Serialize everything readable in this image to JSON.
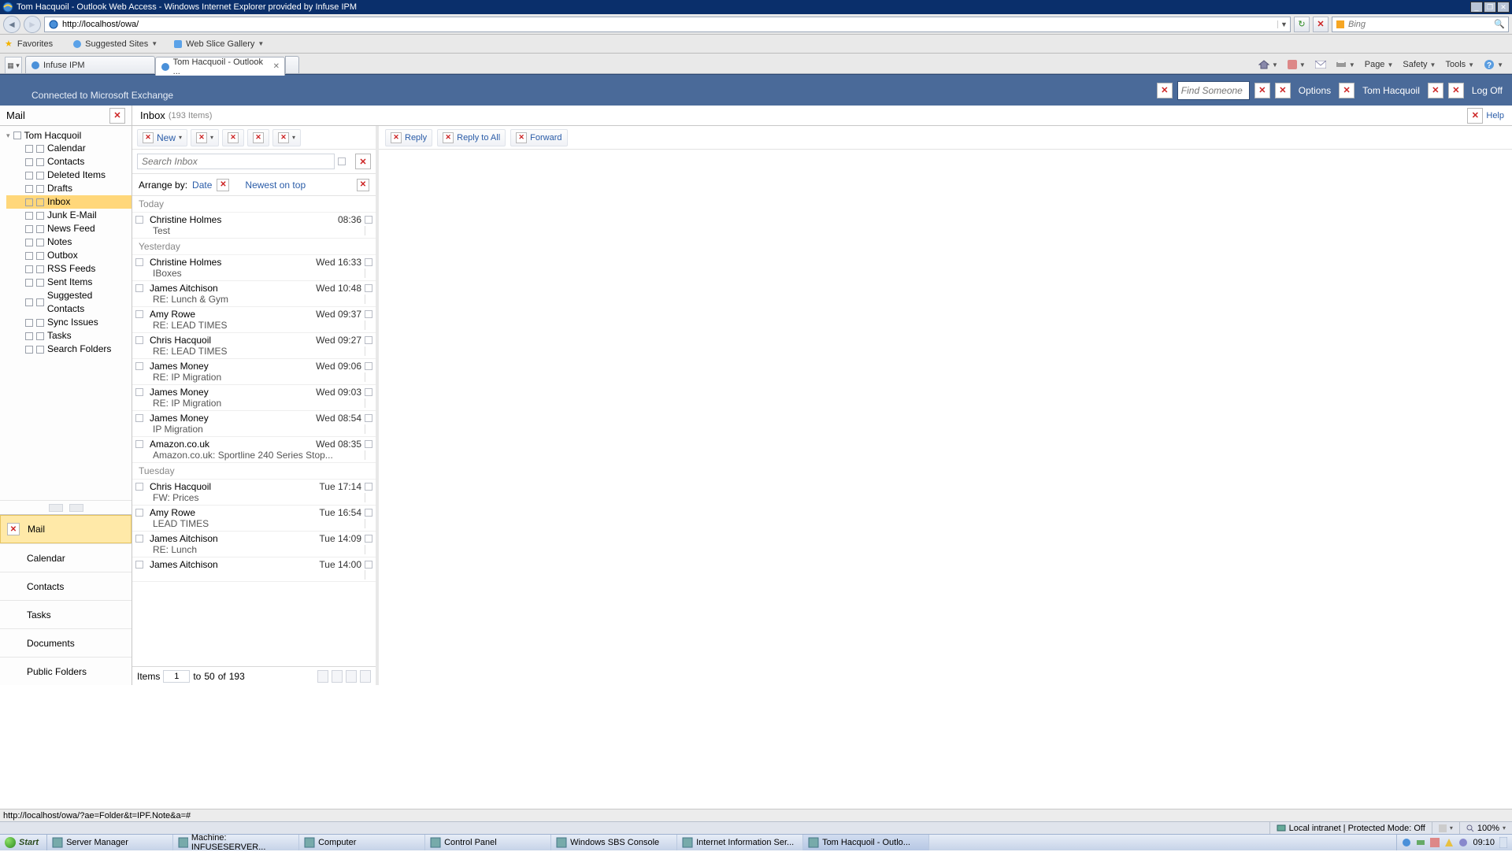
{
  "window": {
    "title": "Tom Hacquoil - Outlook Web Access - Windows Internet Explorer provided by Infuse IPM"
  },
  "ie": {
    "url": "http://localhost/owa/",
    "search_engine": "Bing",
    "favorites_label": "Favorites",
    "suggested_sites": "Suggested Sites",
    "web_slice": "Web Slice Gallery",
    "tabs": [
      {
        "label": "Infuse IPM",
        "active": false
      },
      {
        "label": "Tom Hacquoil - Outlook ...",
        "active": true
      }
    ],
    "menu": {
      "page": "Page",
      "safety": "Safety",
      "tools": "Tools"
    }
  },
  "owa": {
    "connected": "Connected to Microsoft Exchange",
    "find_placeholder": "Find Someone",
    "options": "Options",
    "user": "Tom Hacquoil",
    "logoff": "Log Off"
  },
  "sidebar": {
    "title": "Mail",
    "root": "Tom Hacquoil",
    "folders": [
      "Calendar",
      "Contacts",
      "Deleted Items",
      "Drafts",
      "Inbox",
      "Junk E-Mail",
      "News Feed",
      "Notes",
      "Outbox",
      "RSS Feeds",
      "Sent Items",
      "Suggested Contacts",
      "Sync Issues",
      "Tasks",
      "Search Folders"
    ],
    "selected": "Inbox",
    "nav": [
      "Mail",
      "Calendar",
      "Contacts",
      "Tasks",
      "Documents",
      "Public Folders"
    ]
  },
  "inbox": {
    "title": "Inbox",
    "count_label": "(193 Items)",
    "help": "Help",
    "new": "New",
    "reply": "Reply",
    "reply_all": "Reply to All",
    "forward": "Forward",
    "search_placeholder": "Search Inbox",
    "arrange_by": "Arrange by:",
    "arrange_field": "Date",
    "sort": "Newest on top",
    "pager": {
      "items": "Items",
      "page": "1",
      "to": "to",
      "range_end": "50",
      "of": "of",
      "total": "193"
    }
  },
  "groups": [
    {
      "label": "Today",
      "items": [
        {
          "from": "Christine Holmes",
          "time": "08:36",
          "subject": "Test"
        }
      ]
    },
    {
      "label": "Yesterday",
      "items": [
        {
          "from": "Christine Holmes",
          "time": "Wed 16:33",
          "subject": "IBoxes"
        },
        {
          "from": "James Aitchison",
          "time": "Wed 10:48",
          "subject": "RE: Lunch & Gym"
        },
        {
          "from": "Amy Rowe",
          "time": "Wed 09:37",
          "subject": "RE: LEAD TIMES"
        },
        {
          "from": "Chris Hacquoil",
          "time": "Wed 09:27",
          "subject": "RE: LEAD TIMES"
        },
        {
          "from": "James Money",
          "time": "Wed 09:06",
          "subject": "RE: IP Migration"
        },
        {
          "from": "James Money",
          "time": "Wed 09:03",
          "subject": "RE: IP Migration"
        },
        {
          "from": "James Money",
          "time": "Wed 08:54",
          "subject": "IP Migration"
        },
        {
          "from": "Amazon.co.uk",
          "time": "Wed 08:35",
          "subject": "Amazon.co.uk: Sportline 240 Series Stop..."
        }
      ]
    },
    {
      "label": "Tuesday",
      "items": [
        {
          "from": "Chris Hacquoil",
          "time": "Tue 17:14",
          "subject": "FW: Prices"
        },
        {
          "from": "Amy Rowe",
          "time": "Tue 16:54",
          "subject": "LEAD TIMES"
        },
        {
          "from": "James Aitchison",
          "time": "Tue 14:09",
          "subject": "RE: Lunch"
        },
        {
          "from": "James Aitchison",
          "time": "Tue 14:00",
          "subject": ""
        }
      ]
    }
  ],
  "status": {
    "hover_url": "http://localhost/owa/?ae=Folder&t=IPF.Note&a=#",
    "zone": "Local intranet | Protected Mode: Off",
    "zoom": "100%"
  },
  "taskbar": {
    "start": "Start",
    "items": [
      "Server Manager",
      "Machine: INFUSESERVER...",
      "Computer",
      "Control Panel",
      "Windows SBS Console",
      "Internet Information Ser...",
      "Tom Hacquoil - Outlo..."
    ],
    "clock": "09:10"
  }
}
